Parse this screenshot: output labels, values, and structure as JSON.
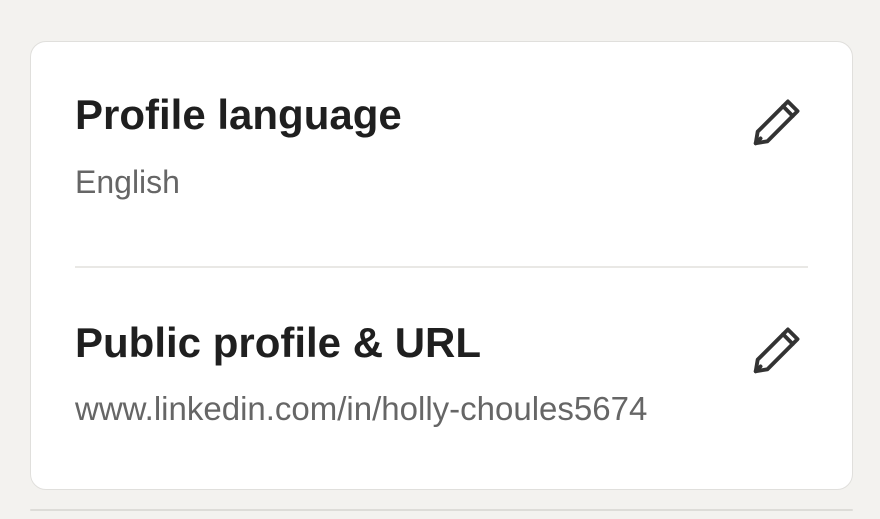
{
  "card": {
    "profile_language": {
      "title": "Profile language",
      "value": "English",
      "edit_icon": "pencil-icon"
    },
    "public_profile": {
      "title": "Public profile & URL",
      "value": "www.linkedin.com/in/holly-choules5674",
      "edit_icon": "pencil-icon"
    }
  },
  "colors": {
    "background": "#f3f2ef",
    "card": "#ffffff",
    "title": "#1f1f1f",
    "subtitle": "#666666",
    "icon": "#333333"
  }
}
